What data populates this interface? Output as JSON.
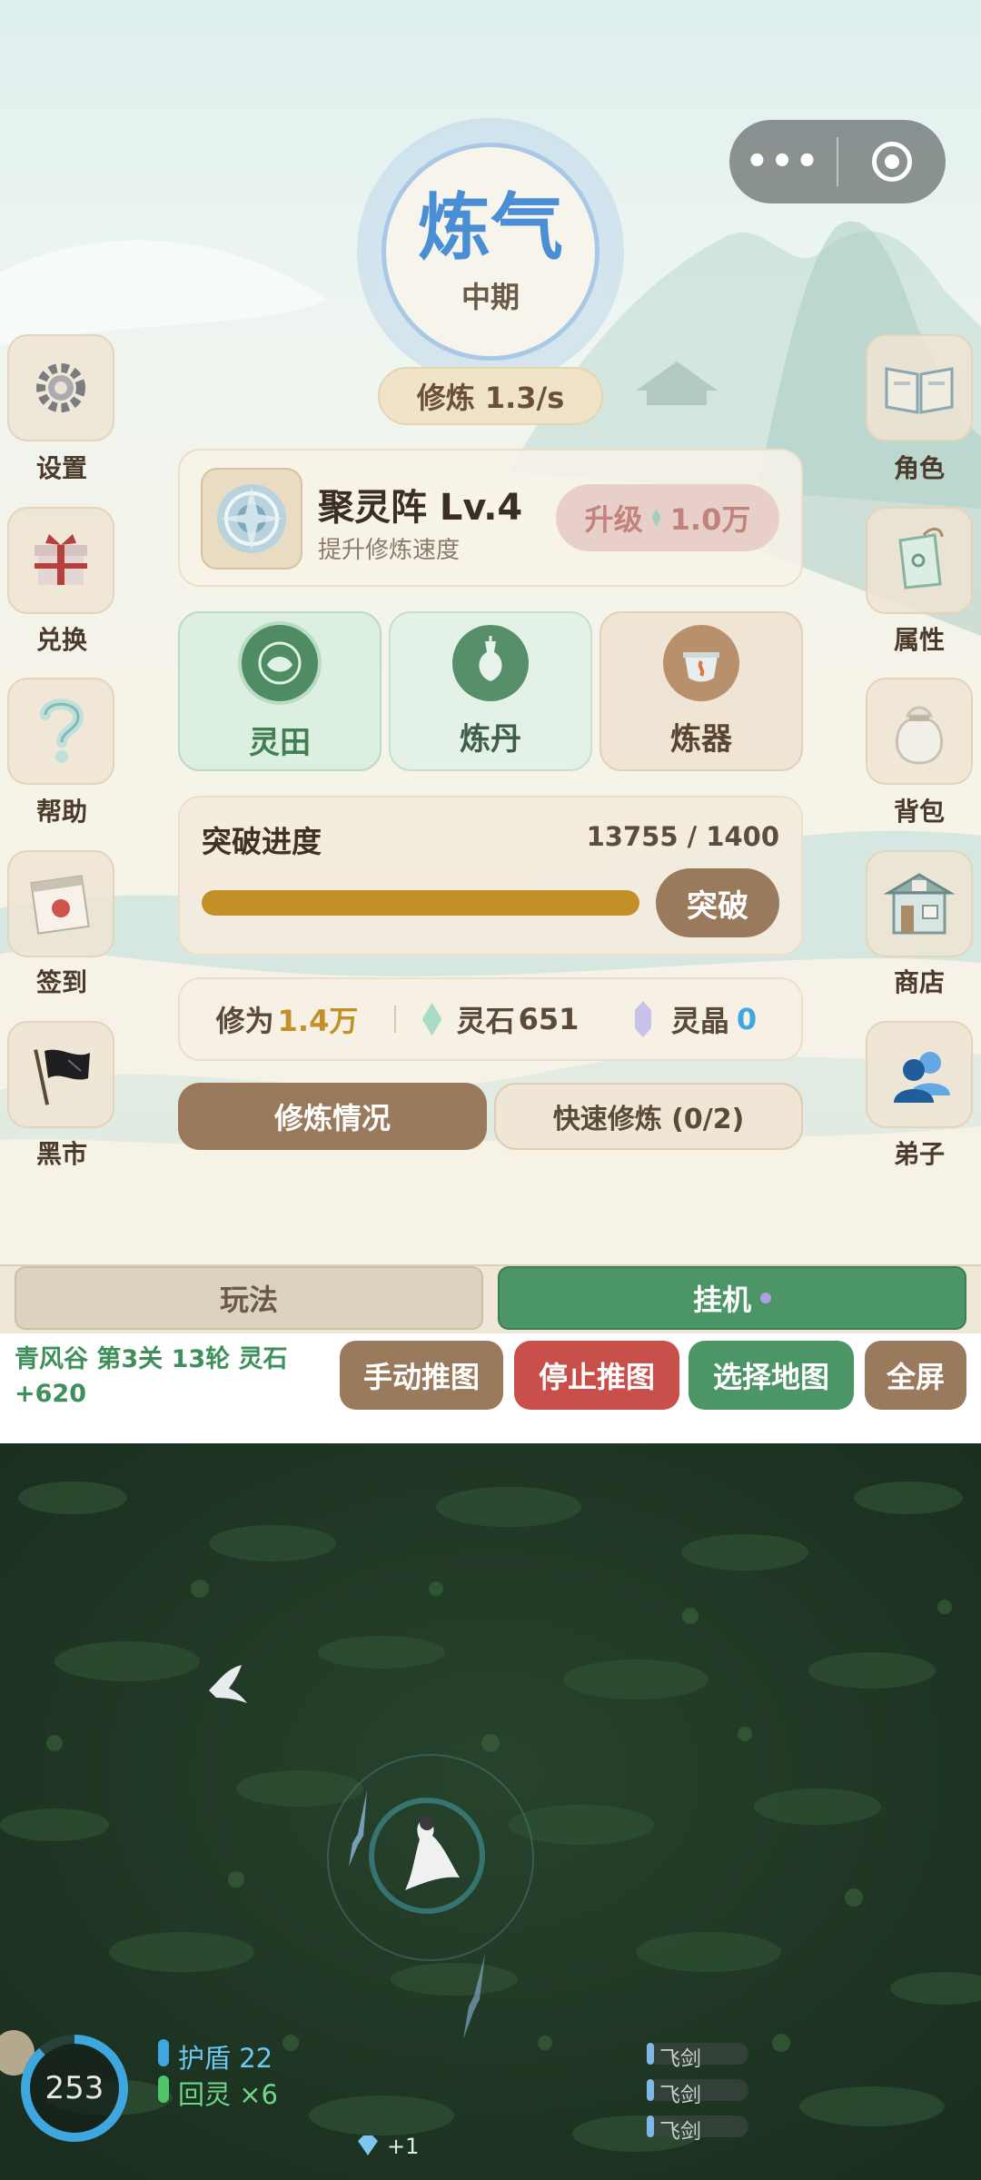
{
  "colors": {
    "realm_blue": "#4a8fd6",
    "brown": "#9a7a5c",
    "green": "#4b9566",
    "red": "#c9504a",
    "gold_bar": "#c39028",
    "shield_blue": "#3fa7df",
    "regen_green": "#4fc56a"
  },
  "capsule": {
    "more_icon": "more-dots-icon",
    "record_icon": "target-icon"
  },
  "realm": {
    "name": "炼气",
    "stage": "中期"
  },
  "cultivation_rate": "修炼 1.3/s",
  "left_menu": [
    {
      "label": "设置",
      "icon": "gear-icon"
    },
    {
      "label": "兑换",
      "icon": "gift-box-icon"
    },
    {
      "label": "帮助",
      "icon": "question-icon"
    },
    {
      "label": "签到",
      "icon": "calendar-icon"
    },
    {
      "label": "黑市",
      "icon": "black-flag-icon"
    }
  ],
  "right_menu": [
    {
      "label": "角色",
      "icon": "book-icon"
    },
    {
      "label": "属性",
      "icon": "tag-icon"
    },
    {
      "label": "背包",
      "icon": "bag-icon"
    },
    {
      "label": "商店",
      "icon": "shop-icon"
    },
    {
      "label": "弟子",
      "icon": "disciples-icon"
    }
  ],
  "array": {
    "name": "聚灵阵 Lv.4",
    "desc": "提升修炼速度",
    "upgrade_label": "升级",
    "upgrade_cost": "1.0万"
  },
  "skills": [
    {
      "label": "灵田",
      "icon": "spirit-field-icon"
    },
    {
      "label": "炼丹",
      "icon": "alchemy-vase-icon"
    },
    {
      "label": "炼器",
      "icon": "cauldron-icon"
    }
  ],
  "breakthrough": {
    "title": "突破进度",
    "progress_text": "13755 / 1400",
    "progress_fraction": 1.0,
    "button": "突破"
  },
  "resources": {
    "cultivation_label": "修为",
    "cultivation_value": "1.4万",
    "stone_label": "灵石",
    "stone_value": "651",
    "crystal_label": "灵晶",
    "crystal_value": "0"
  },
  "actions": {
    "status": "修炼情况",
    "quick": "快速修炼 (0/2)"
  },
  "tabs": {
    "play": "玩法",
    "idle": "挂机"
  },
  "stage_info": "青风谷 第3关  13轮  灵石+620",
  "controls": {
    "manual": "手动推图",
    "stop": "停止推图",
    "select": "选择地图",
    "fullscreen": "全屏"
  },
  "game_hud": {
    "hp": "253",
    "shield_label": "护盾",
    "shield_value": "22",
    "regen_label": "回灵",
    "regen_value": "×6",
    "gem_gain": "+1",
    "skill_slots": [
      "飞剑",
      "飞剑",
      "飞剑"
    ]
  }
}
